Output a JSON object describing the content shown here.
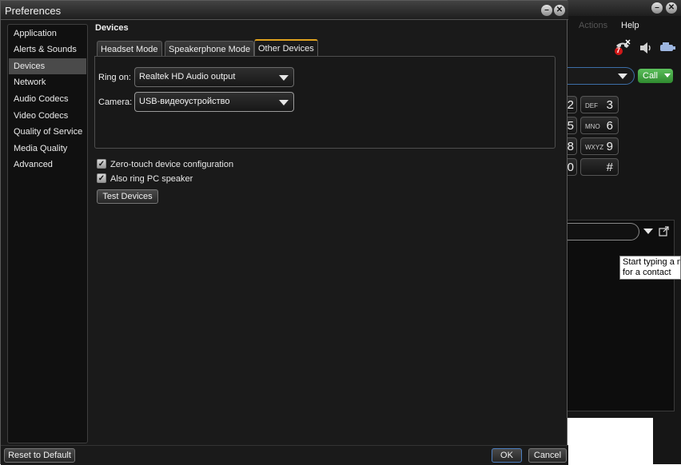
{
  "dialog": {
    "title": "Preferences",
    "content_title": "Devices"
  },
  "nav": {
    "items": [
      {
        "label": "Application"
      },
      {
        "label": "Alerts & Sounds"
      },
      {
        "label": "Devices",
        "selected": true
      },
      {
        "label": "Network"
      },
      {
        "label": "Audio Codecs"
      },
      {
        "label": "Video Codecs"
      },
      {
        "label": "Quality of Service"
      },
      {
        "label": "Media Quality"
      },
      {
        "label": "Advanced"
      }
    ]
  },
  "tabs": [
    {
      "label": "Headset Mode"
    },
    {
      "label": "Speakerphone Mode"
    },
    {
      "label": "Other Devices",
      "active": true
    }
  ],
  "other_devices": {
    "ring_on_label": "Ring on:",
    "ring_on_value": "Realtek HD Audio output",
    "camera_label": "Camera:",
    "camera_value": "USB-видеоустройство"
  },
  "options": {
    "zero_touch": {
      "label": "Zero-touch device configuration",
      "checked": true
    },
    "also_ring": {
      "label": "Also ring PC speaker",
      "checked": true
    },
    "test_devices_label": "Test Devices"
  },
  "footer": {
    "reset_label": "Reset to Default",
    "ok_label": "OK",
    "cancel_label": "Cancel"
  },
  "background_app": {
    "menu": {
      "actions": "Actions",
      "help": "Help"
    },
    "call_label": "Call",
    "missed_count": "7",
    "keys": [
      {
        "number": "2",
        "letters": ""
      },
      {
        "number": "3",
        "letters": "DEF"
      },
      {
        "number": "5",
        "letters": ""
      },
      {
        "number": "6",
        "letters": "MNO"
      },
      {
        "number": "8",
        "letters": ""
      },
      {
        "number": "9",
        "letters": "WXYZ"
      },
      {
        "number": "0",
        "letters": ""
      },
      {
        "number": "#",
        "letters": ""
      }
    ],
    "tooltip_line1": "Start typing a n",
    "tooltip_line2": "for a contact"
  },
  "colors": {
    "active_tab_accent": "#e0a21e",
    "call_green": "#3a9e3a",
    "selected_nav": "#4a4a4a"
  },
  "icons": [
    "minimize-icon",
    "close-icon",
    "missed-call-icon",
    "speaker-icon",
    "headset-icon",
    "chevron-down-icon",
    "popout-icon",
    "checkmark-icon"
  ]
}
